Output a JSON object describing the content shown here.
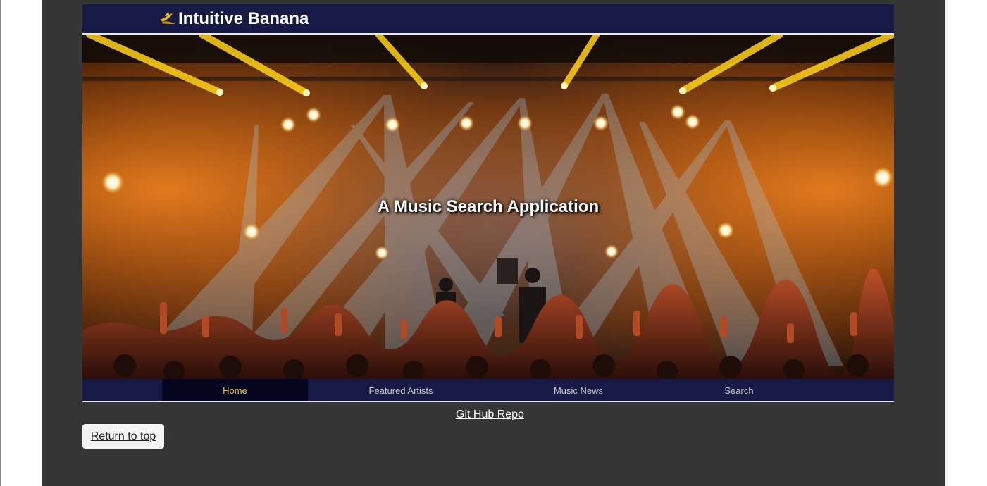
{
  "header": {
    "title": "Intuitive Banana",
    "logo_icon": "banana-bird-icon"
  },
  "hero": {
    "tagline": "A Music Search Application",
    "image": "concert-stage-lights-crowd"
  },
  "nav": {
    "items": [
      {
        "label": "Home",
        "active": true
      },
      {
        "label": "Featured Artists",
        "active": false
      },
      {
        "label": "Music News",
        "active": false
      },
      {
        "label": "Search",
        "active": false
      }
    ]
  },
  "footer": {
    "repo_link": "Git Hub Repo",
    "return_button": "Return to top"
  },
  "colors": {
    "page_bg": "#353535",
    "bar_bg": "#161a45",
    "active_nav_bg": "#05051f",
    "active_nav_text": "#e8c840"
  }
}
